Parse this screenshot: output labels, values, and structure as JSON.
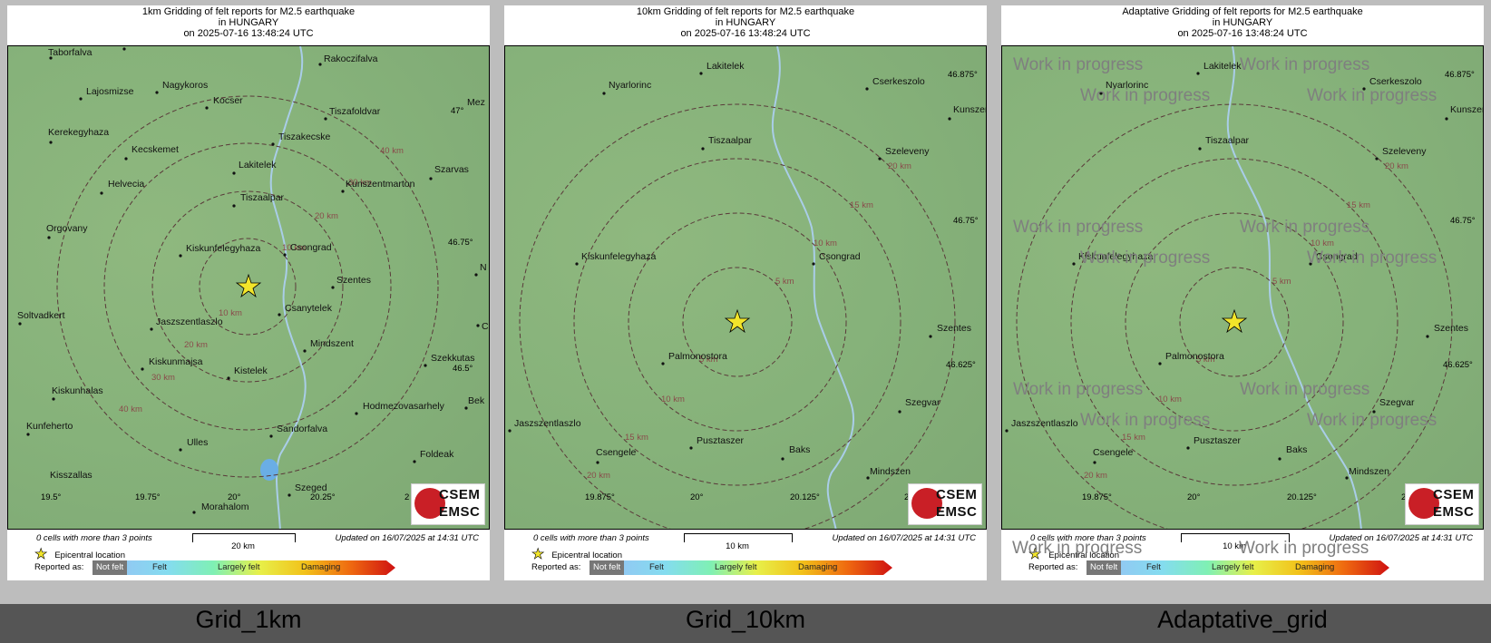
{
  "panels": [
    {
      "title_lines": [
        "1km Gridding of felt reports for M2.5 earthquake",
        "in HUNGARY",
        "on  2025-07-16 13:48:24 UTC"
      ],
      "caption": "Grid_1km",
      "scale_label": "20 km",
      "cells_text": "0 cells with more than 3 points",
      "updated_text": "Updated on 16/07/2025 at 14:31 UTC",
      "cities": [
        "Taborfalva",
        "Rakoczifalva",
        "Nagykoros",
        "Lajosmizse",
        "Kocser",
        "Tiszafoldvar",
        "Mez",
        "Kerekegyhaza",
        "Kecskemet",
        "Tiszakecske",
        "Lakitelek",
        "Szarvas",
        "Helvecia",
        "Kunszentmarton",
        "Tiszaalpar",
        "Orgovany",
        "Kiskunfelegyhaza",
        "Csongrad",
        "Szentes",
        "Soltvadkert",
        "Jaszszentlaszlo",
        "Csanytelek",
        "Mindszent",
        "Kiskunmajsa",
        "Kistelek",
        "Szekkutas",
        "Kiskunhalas",
        "Hodmezovasarhely",
        "Bek",
        "Kunfeherto",
        "Ulles",
        "Sandorfalva",
        "Foldeak",
        "Kisszallas",
        "Szeged",
        "Morahalom",
        "N",
        "C"
      ],
      "ring_labels": [
        "10 km",
        "10 km",
        "20 km",
        "20 km",
        "30 km",
        "30 km",
        "40 km",
        "40 km"
      ],
      "coords": [
        "47°",
        "46.75°",
        "46.5°",
        "19.5°",
        "19.75°",
        "20°",
        "20.25°",
        "2"
      ]
    },
    {
      "title_lines": [
        "10km Gridding of felt reports for M2.5 earthquake",
        "in HUNGARY",
        "on  2025-07-16 13:48:24 UTC"
      ],
      "caption": "Grid_10km",
      "scale_label": "10 km",
      "cells_text": "0 cells with more than 3 points",
      "updated_text": "Updated on 16/07/2025 at 14:31 UTC",
      "cities": [
        "Lakitelek",
        "Nyarlorinc",
        "Cserkeszolo",
        "Kunszen",
        "Tiszaalpar",
        "Szeleveny",
        "Kiskunfelegyhaza",
        "Csongrad",
        "Szentes",
        "Palmonostora",
        "Szegvar",
        "Jaszszentlaszlo",
        "Pusztaszer",
        "Baks",
        "Csengele",
        "Mindszen"
      ],
      "ring_labels": [
        "5 km",
        "5 km",
        "10 km",
        "10 km",
        "15 km",
        "15 km",
        "20 km",
        "20 km"
      ],
      "coords": [
        "46.875°",
        "46.75°",
        "46.625°",
        "19.875°",
        "20°",
        "20.125°",
        "20"
      ]
    },
    {
      "title_lines": [
        "Adaptative Gridding of felt reports for M2.5 earthquake",
        "in HUNGARY",
        "on  2025-07-16 13:48:24 UTC"
      ],
      "caption": "Adaptative_grid",
      "scale_label": "10 km",
      "cells_text": "0 cells with more than 3 points",
      "updated_text": "Updated on 16/07/2025 at 14:31 UTC",
      "cities": [
        "Lakitelek",
        "Nyarlorinc",
        "Cserkeszolo",
        "Kunszen",
        "Tiszaalpar",
        "Szeleveny",
        "Kiskunfelegyhaza",
        "Csongrad",
        "Szentes",
        "Palmonostora",
        "Szegvar",
        "Jaszszentlaszlo",
        "Pusztaszer",
        "Baks",
        "Csengele",
        "Mindszen"
      ],
      "ring_labels": [
        "5 km",
        "5 km",
        "10 km",
        "10 km",
        "15 km",
        "15 km",
        "20 km",
        "20 km"
      ],
      "coords": [
        "46.875°",
        "46.75°",
        "46.625°",
        "19.875°",
        "20°",
        "20.125°",
        "20"
      ],
      "watermark": "Work in progress"
    }
  ],
  "legend": {
    "epicentral": "Epicentral location",
    "reported_as": "Reported as:",
    "levels": [
      "Not felt",
      "Felt",
      "Largely felt",
      "Damaging"
    ]
  },
  "logo": {
    "line1": "CSEM",
    "line2": "EMSC"
  },
  "colors": {
    "ring": "#5a3a3a",
    "star": "#f2e52a",
    "map_green": "#86b27a",
    "river": "#a9cde8",
    "logo_red": "#c91f26"
  }
}
